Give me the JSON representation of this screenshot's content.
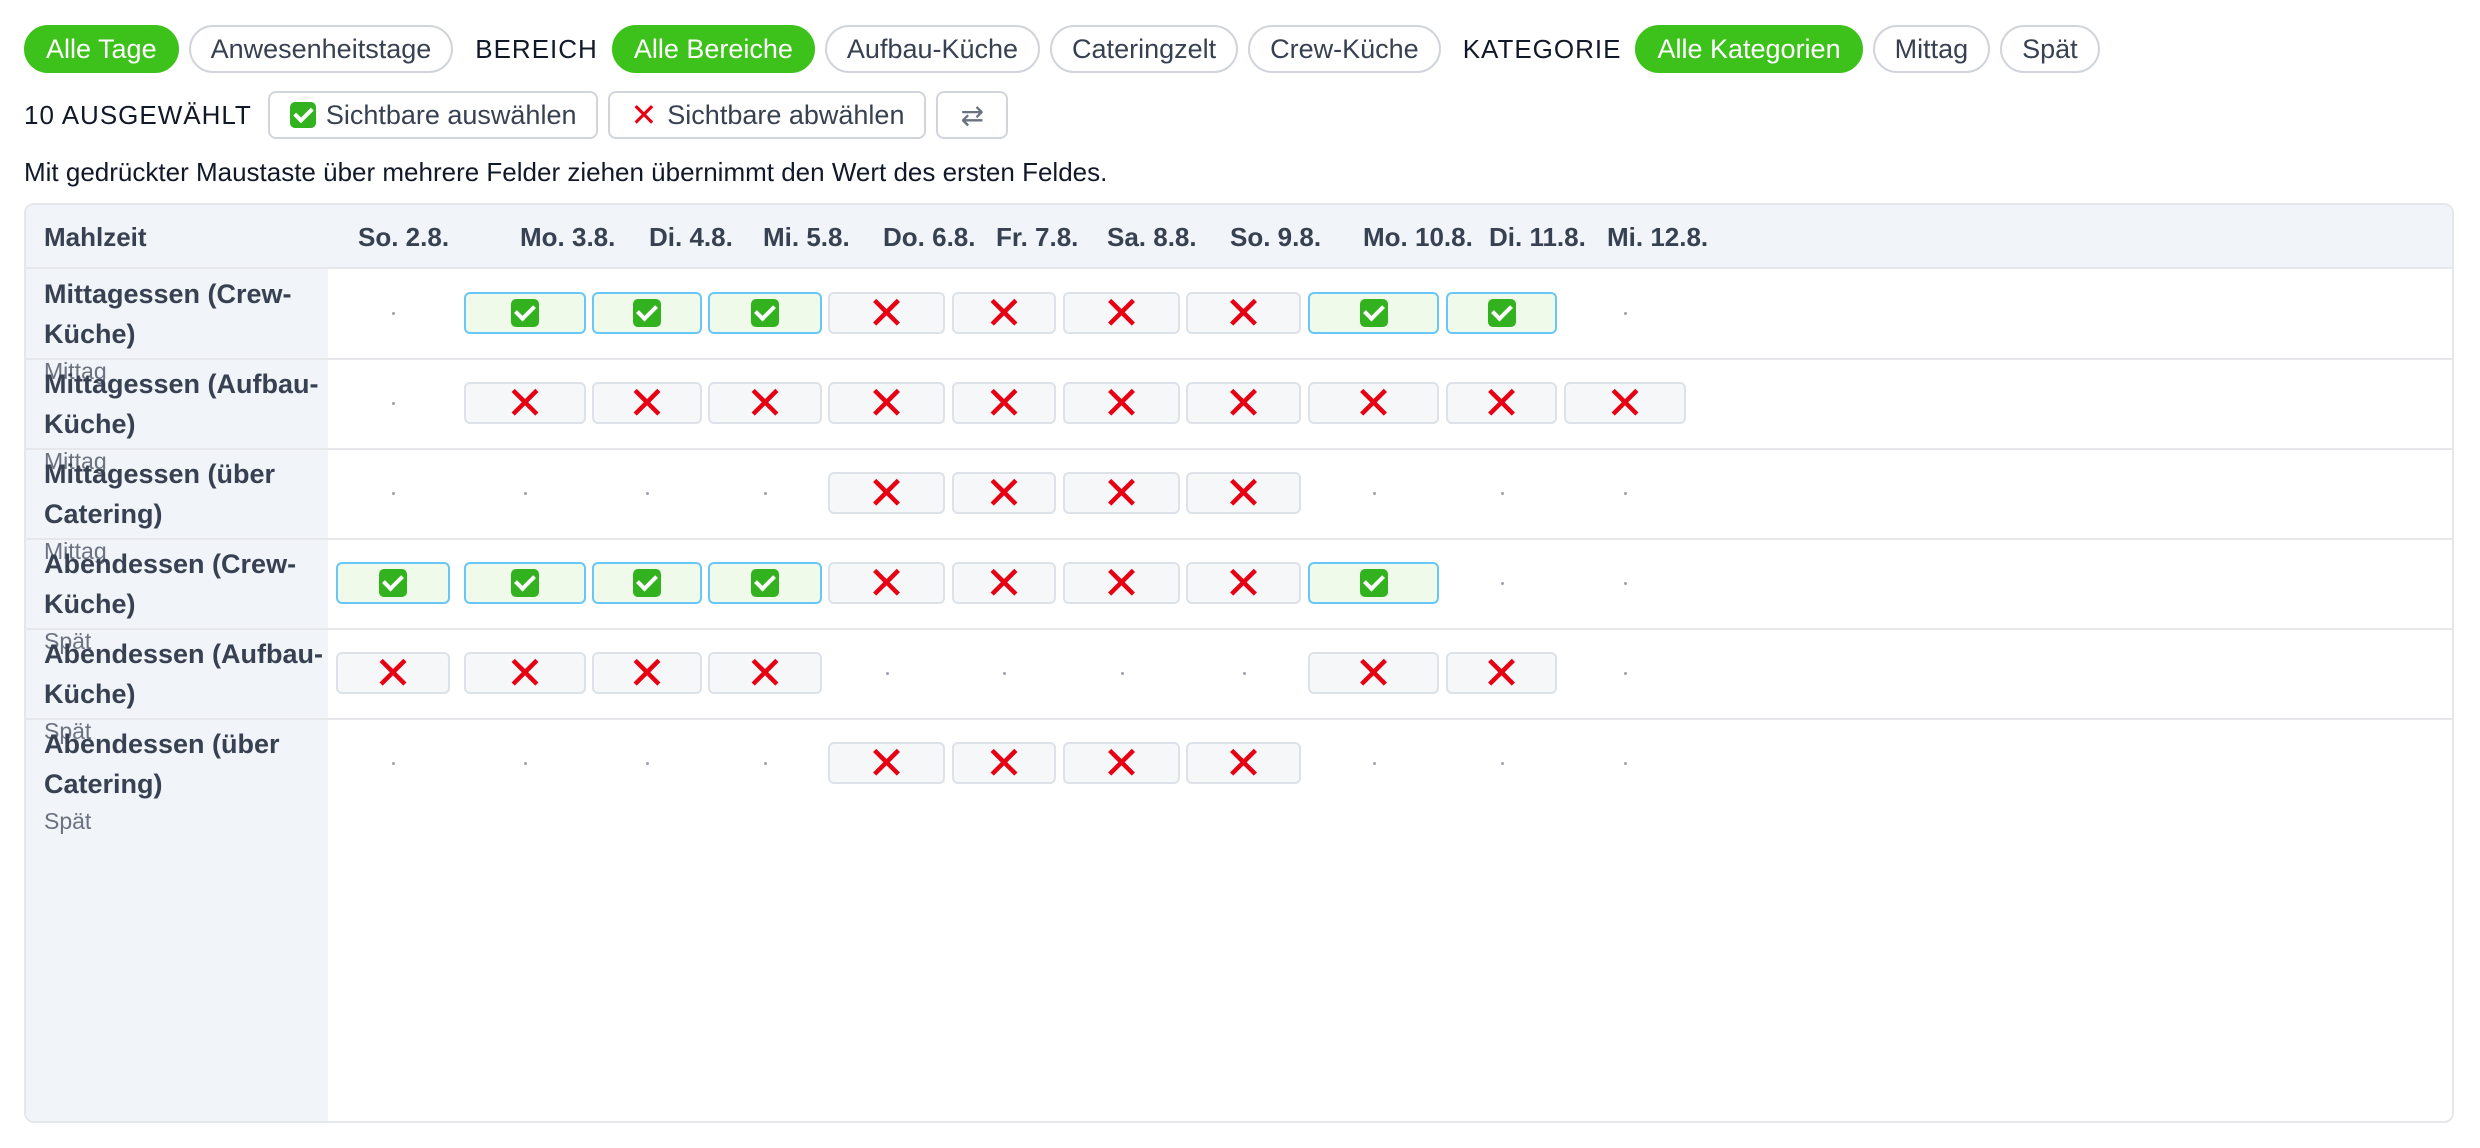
{
  "filters": {
    "days": [
      {
        "label": "Alle Tage",
        "active": true
      },
      {
        "label": "Anwesenheitstage",
        "active": false
      }
    ],
    "area_label": "Bereich",
    "areas": [
      {
        "label": "Alle Bereiche",
        "active": true
      },
      {
        "label": "Aufbau-Küche",
        "active": false
      },
      {
        "label": "Cateringzelt",
        "active": false
      },
      {
        "label": "Crew-Küche",
        "active": false
      }
    ],
    "category_label": "Kategorie",
    "categories": [
      {
        "label": "Alle Kategorien",
        "active": true
      },
      {
        "label": "Mittag",
        "active": false
      },
      {
        "label": "Spät",
        "active": false
      }
    ]
  },
  "selection": {
    "count_text": "10 AUSGEWÄHLT",
    "select_visible": "Sichtbare auswählen",
    "deselect_visible": "Sichtbare abwählen",
    "swap_glyph": "⇄"
  },
  "hint": "Mit gedrückter Maustaste über mehrere Felder ziehen übernimmt den Wert des ersten Feldes.",
  "table": {
    "corner": "Mahlzeit",
    "days": [
      "So. 2.8.",
      "Mo. 3.8.",
      "Di. 4.8.",
      "Mi. 5.8.",
      "Do. 6.8.",
      "Fr. 7.8.",
      "Sa. 8.8.",
      "So. 9.8.",
      "Mo. 10.8.",
      "Di. 11.8.",
      "Mi. 12.8."
    ],
    "rows": [
      {
        "name": "Mittagessen (Crew-Küche)",
        "category": "Mittag",
        "cells": [
          "none",
          "yes",
          "yes",
          "yes",
          "no",
          "no",
          "no",
          "no",
          "yes",
          "yes",
          "none"
        ]
      },
      {
        "name": "Mittagessen (Aufbau-Küche)",
        "category": "Mittag",
        "cells": [
          "none",
          "no",
          "no",
          "no",
          "no",
          "no",
          "no",
          "no",
          "no",
          "no",
          "no"
        ]
      },
      {
        "name": "Mittagessen (über Catering)",
        "category": "Mittag",
        "cells": [
          "none",
          "none",
          "none",
          "none",
          "no",
          "no",
          "no",
          "no",
          "none",
          "none",
          "none"
        ]
      },
      {
        "name": "Abendessen (Crew-Küche)",
        "category": "Spät",
        "cells": [
          "yes",
          "yes",
          "yes",
          "yes",
          "no",
          "no",
          "no",
          "no",
          "yes",
          "none",
          "none"
        ]
      },
      {
        "name": "Abendessen (Aufbau-Küche)",
        "category": "Spät",
        "cells": [
          "no",
          "no",
          "no",
          "no",
          "none",
          "none",
          "none",
          "none",
          "no",
          "no",
          "none"
        ]
      },
      {
        "name": "Abendessen (über Catering)",
        "category": "Spät",
        "cells": [
          "none",
          "none",
          "none",
          "none",
          "no",
          "no",
          "no",
          "no",
          "none",
          "none",
          "none"
        ]
      }
    ]
  },
  "colors": {
    "accent": "#3cc21a",
    "selected_border": "#69c7f7",
    "cross": "#e60012"
  }
}
